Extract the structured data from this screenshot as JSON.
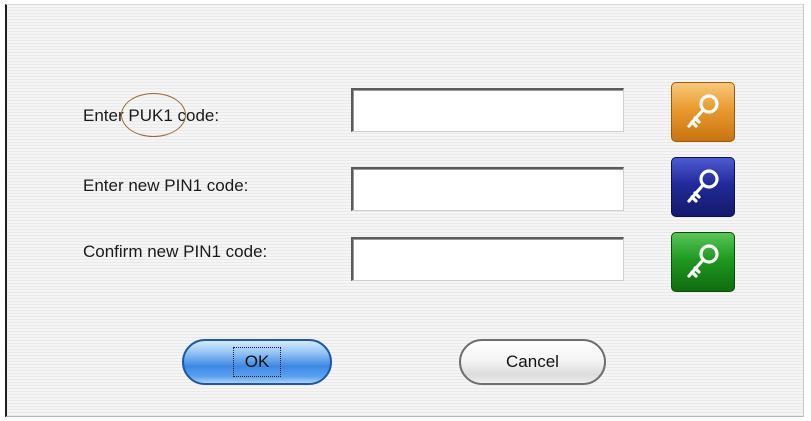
{
  "dialog": {
    "fields": [
      {
        "label_prefix": "Enter ",
        "label_highlight": "PUK1",
        "label_suffix": " code:",
        "value": "",
        "key_color": "#e99a2e",
        "key_icon": "key-icon"
      },
      {
        "label": "Enter new PIN1 code:",
        "value": "",
        "key_color": "#222a9a",
        "key_icon": "key-icon"
      },
      {
        "label": "Confirm new PIN1 code:",
        "value": "",
        "key_color": "#1f9a1f",
        "key_icon": "key-icon"
      }
    ],
    "buttons": {
      "ok_label": "OK",
      "cancel_label": "Cancel"
    },
    "colors": {
      "highlight_circle": "#9a6a36",
      "ok_button": "#3c88e3"
    }
  }
}
